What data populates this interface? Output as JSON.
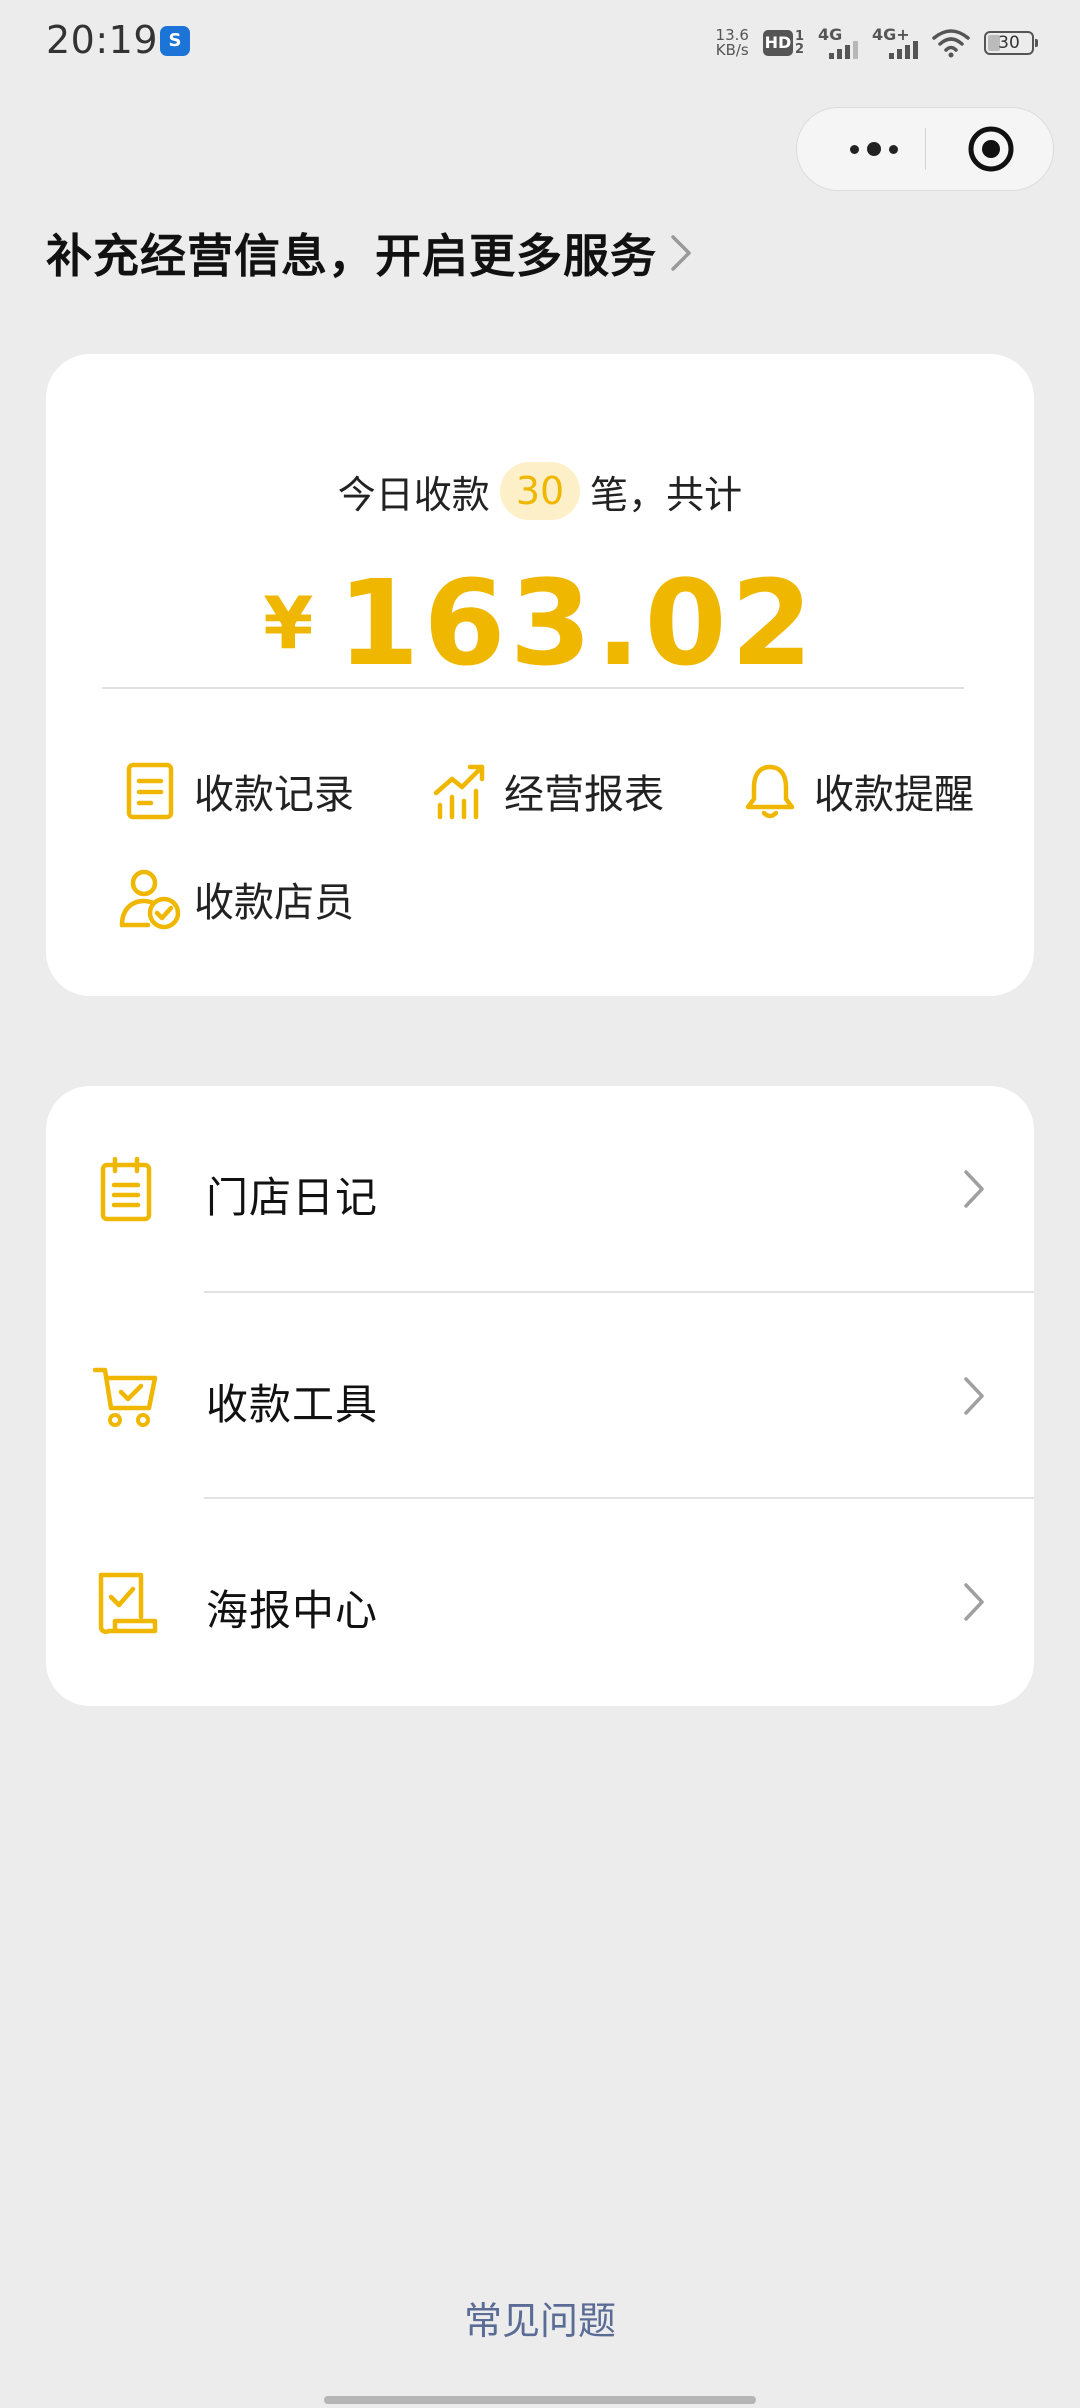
{
  "status_bar": {
    "time": "20:19",
    "app_icon": "app-notification-icon",
    "net_speed_value": "13.6",
    "net_speed_unit": "KB/s",
    "hd_label": "HD",
    "hd_sub_top": "1",
    "hd_sub_bottom": "2",
    "signal1_label": "4G",
    "signal2_label": "4G+",
    "battery": "30"
  },
  "capsule": {
    "more_icon": "more-dots-icon",
    "close_icon": "target-close-icon"
  },
  "header": {
    "title": "补充经营信息，开启更多服务"
  },
  "summary": {
    "prefix": "今日收款",
    "count": "30",
    "suffix": "笔，共计",
    "currency": "¥",
    "amount": "163.02"
  },
  "quick_actions": [
    {
      "label": "收款记录",
      "icon": "document-icon"
    },
    {
      "label": "经营报表",
      "icon": "chart-trend-icon"
    },
    {
      "label": "收款提醒",
      "icon": "bell-icon"
    },
    {
      "label": "收款店员",
      "icon": "staff-verified-icon"
    }
  ],
  "menu": [
    {
      "label": "门店日记",
      "icon": "notepad-icon"
    },
    {
      "label": "收款工具",
      "icon": "cart-check-icon"
    },
    {
      "label": "海报中心",
      "icon": "poster-check-icon"
    }
  ],
  "footer": {
    "faq": "常见问题"
  },
  "colors": {
    "accent": "#efb700",
    "accent_soft": "#fdf0c8",
    "background": "#ececec",
    "link": "#5a6b95"
  }
}
